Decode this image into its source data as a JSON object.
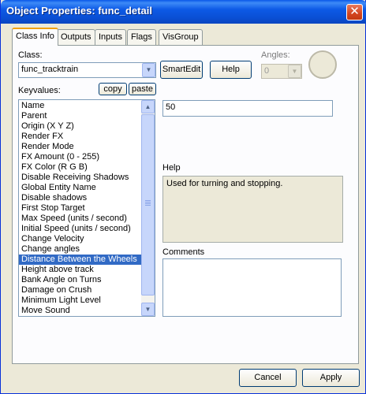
{
  "window": {
    "title": "Object Properties: func_detail",
    "close_glyph": "✕"
  },
  "tabs": [
    "Class Info",
    "Outputs",
    "Inputs",
    "Flags",
    "VisGroup"
  ],
  "class_field": {
    "label": "Class:",
    "value": "func_tracktrain"
  },
  "buttons": {
    "smartedit": "SmartEdit",
    "help": "Help",
    "copy": "copy",
    "paste": "paste",
    "cancel": "Cancel",
    "apply": "Apply"
  },
  "angles": {
    "label": "Angles:",
    "value": "0"
  },
  "keyvalues": {
    "label": "Keyvalues:",
    "items": [
      "Name",
      "Parent",
      "Origin (X Y Z)",
      "Render FX",
      "Render Mode",
      "FX Amount (0 - 255)",
      "FX Color (R G B)",
      "Disable Receiving Shadows",
      "Global Entity Name",
      "Disable shadows",
      "First Stop Target",
      "Max Speed (units / second)",
      "Initial Speed (units / second)",
      "Change Velocity",
      "Change angles",
      "Distance Between the Wheels",
      "Height above track",
      "Bank Angle on Turns",
      "Damage on Crush",
      "Minimum Light Level",
      "Move Sound"
    ],
    "selected_index": 15
  },
  "value_field": {
    "value": "50"
  },
  "help": {
    "label": "Help",
    "text": "Used for turning and stopping."
  },
  "comments": {
    "label": "Comments",
    "text": ""
  },
  "icons": {
    "scroll_up": "▲",
    "scroll_down": "▼",
    "dropdown": "▼"
  }
}
